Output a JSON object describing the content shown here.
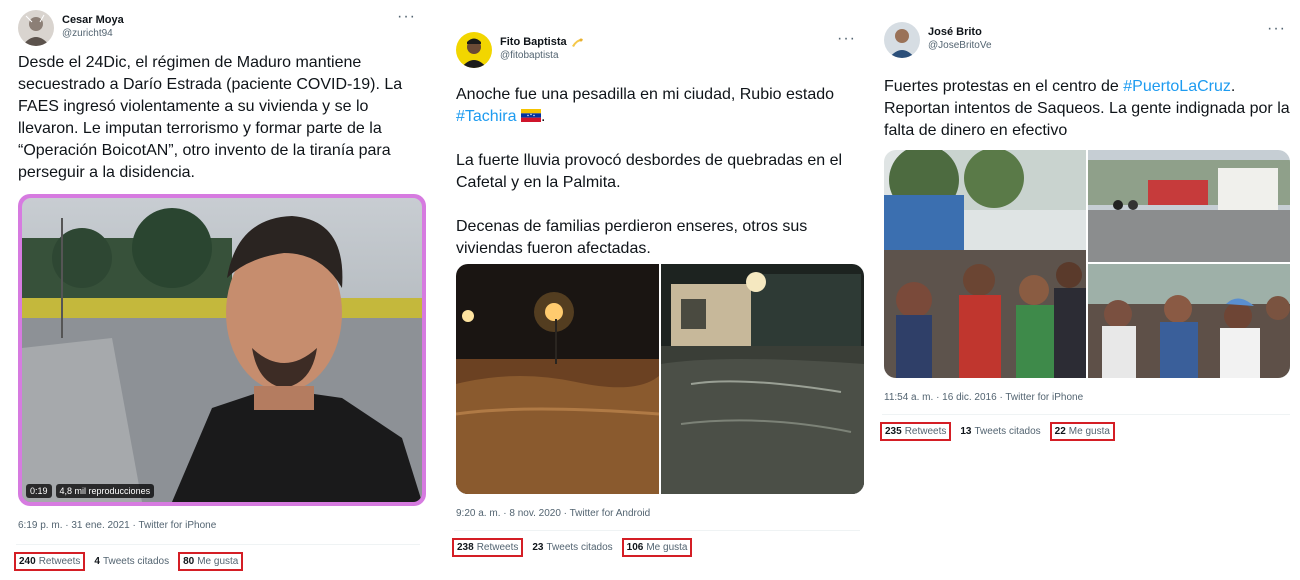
{
  "tweets": [
    {
      "name": "Cesar Moya",
      "handle": "@zuricht94",
      "text": [
        "Desde el 24Dic, el régimen de Maduro mantiene secuestrado a Darío Estrada (paciente COVID-19). La FAES ingresó violentamente a su vivienda y se lo llevaron. Le imputan terrorismo y formar parte de la “Operación BoicotAN”, otro invento de la tiranía para perseguir a la disidencia."
      ],
      "video": {
        "duration": "0:19",
        "views": "4,8 mil reproducciones"
      },
      "meta": "6:19 p. m. · 31 ene. 2021 · Twitter for iPhone",
      "retweets": {
        "count": "240",
        "label": "Retweets"
      },
      "quotes": {
        "count": "4",
        "label": "Tweets citados"
      },
      "likes": {
        "count": "80",
        "label": "Me gusta"
      }
    },
    {
      "name": "Fito Baptista",
      "handle": "@fitobaptista",
      "line1": "Anoche fue una pesadilla en mi ciudad, Rubio estado",
      "hashtag": "#Tachira",
      "para2": "La fuerte lluvia provocó desbordes de quebradas en el Cafetal y en la Palmita.",
      "para3": "Decenas de familias perdieron enseres, otros sus viviendas fueron afectadas.",
      "meta": "9:20 a. m. · 8 nov. 2020 · Twitter for Android",
      "retweets": {
        "count": "238",
        "label": "Retweets"
      },
      "quotes": {
        "count": "23",
        "label": "Tweets citados"
      },
      "likes": {
        "count": "106",
        "label": "Me gusta"
      }
    },
    {
      "name": "José Brito",
      "handle": "@JoseBritoVe",
      "before": "Fuertes protestas en el centro de ",
      "hashtag": "#PuertoLaCruz",
      "after": ". Reportan intentos de Saqueos. La gente indignada por la falta de dinero en efectivo",
      "meta": "11:54 a. m. · 16 dic. 2016 · Twitter for iPhone",
      "retweets": {
        "count": "235",
        "label": "Retweets"
      },
      "quotes": {
        "count": "13",
        "label": "Tweets citados"
      },
      "likes": {
        "count": "22",
        "label": "Me gusta"
      }
    }
  ],
  "colors": {
    "highlight": "#d41e25",
    "link": "#1d9bf0",
    "secondary": "#536471"
  },
  "icons": [
    "more-icon",
    "emoji-icon",
    "flag-icon"
  ]
}
